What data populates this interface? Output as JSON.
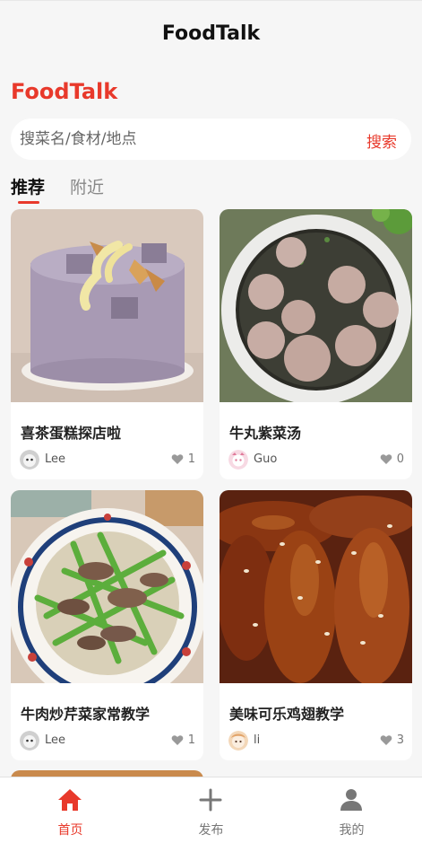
{
  "header": {
    "title": "FoodTalk"
  },
  "brand": {
    "name": "FoodTalk"
  },
  "search": {
    "placeholder": "搜菜名/食材/地点",
    "button_label": "搜索"
  },
  "tabs": [
    {
      "label": "推荐",
      "active": true
    },
    {
      "label": "附近",
      "active": false
    }
  ],
  "feed": [
    {
      "title": "喜茶蛋糕探店啦",
      "author": "Lee",
      "likes": "1"
    },
    {
      "title": "牛丸紫菜汤",
      "author": "Guo",
      "likes": "0"
    },
    {
      "title": "牛肉炒芹菜家常教学",
      "author": "Lee",
      "likes": "1"
    },
    {
      "title": "美味可乐鸡翅教学",
      "author": "li",
      "likes": "3"
    }
  ],
  "bottom_nav": [
    {
      "label": "首页",
      "icon": "home-icon",
      "active": true
    },
    {
      "label": "发布",
      "icon": "plus-icon",
      "active": false
    },
    {
      "label": "我的",
      "icon": "person-icon",
      "active": false
    }
  ],
  "colors": {
    "accent": "#e8392b",
    "background": "#f6f6f6",
    "inactive": "#777777"
  }
}
